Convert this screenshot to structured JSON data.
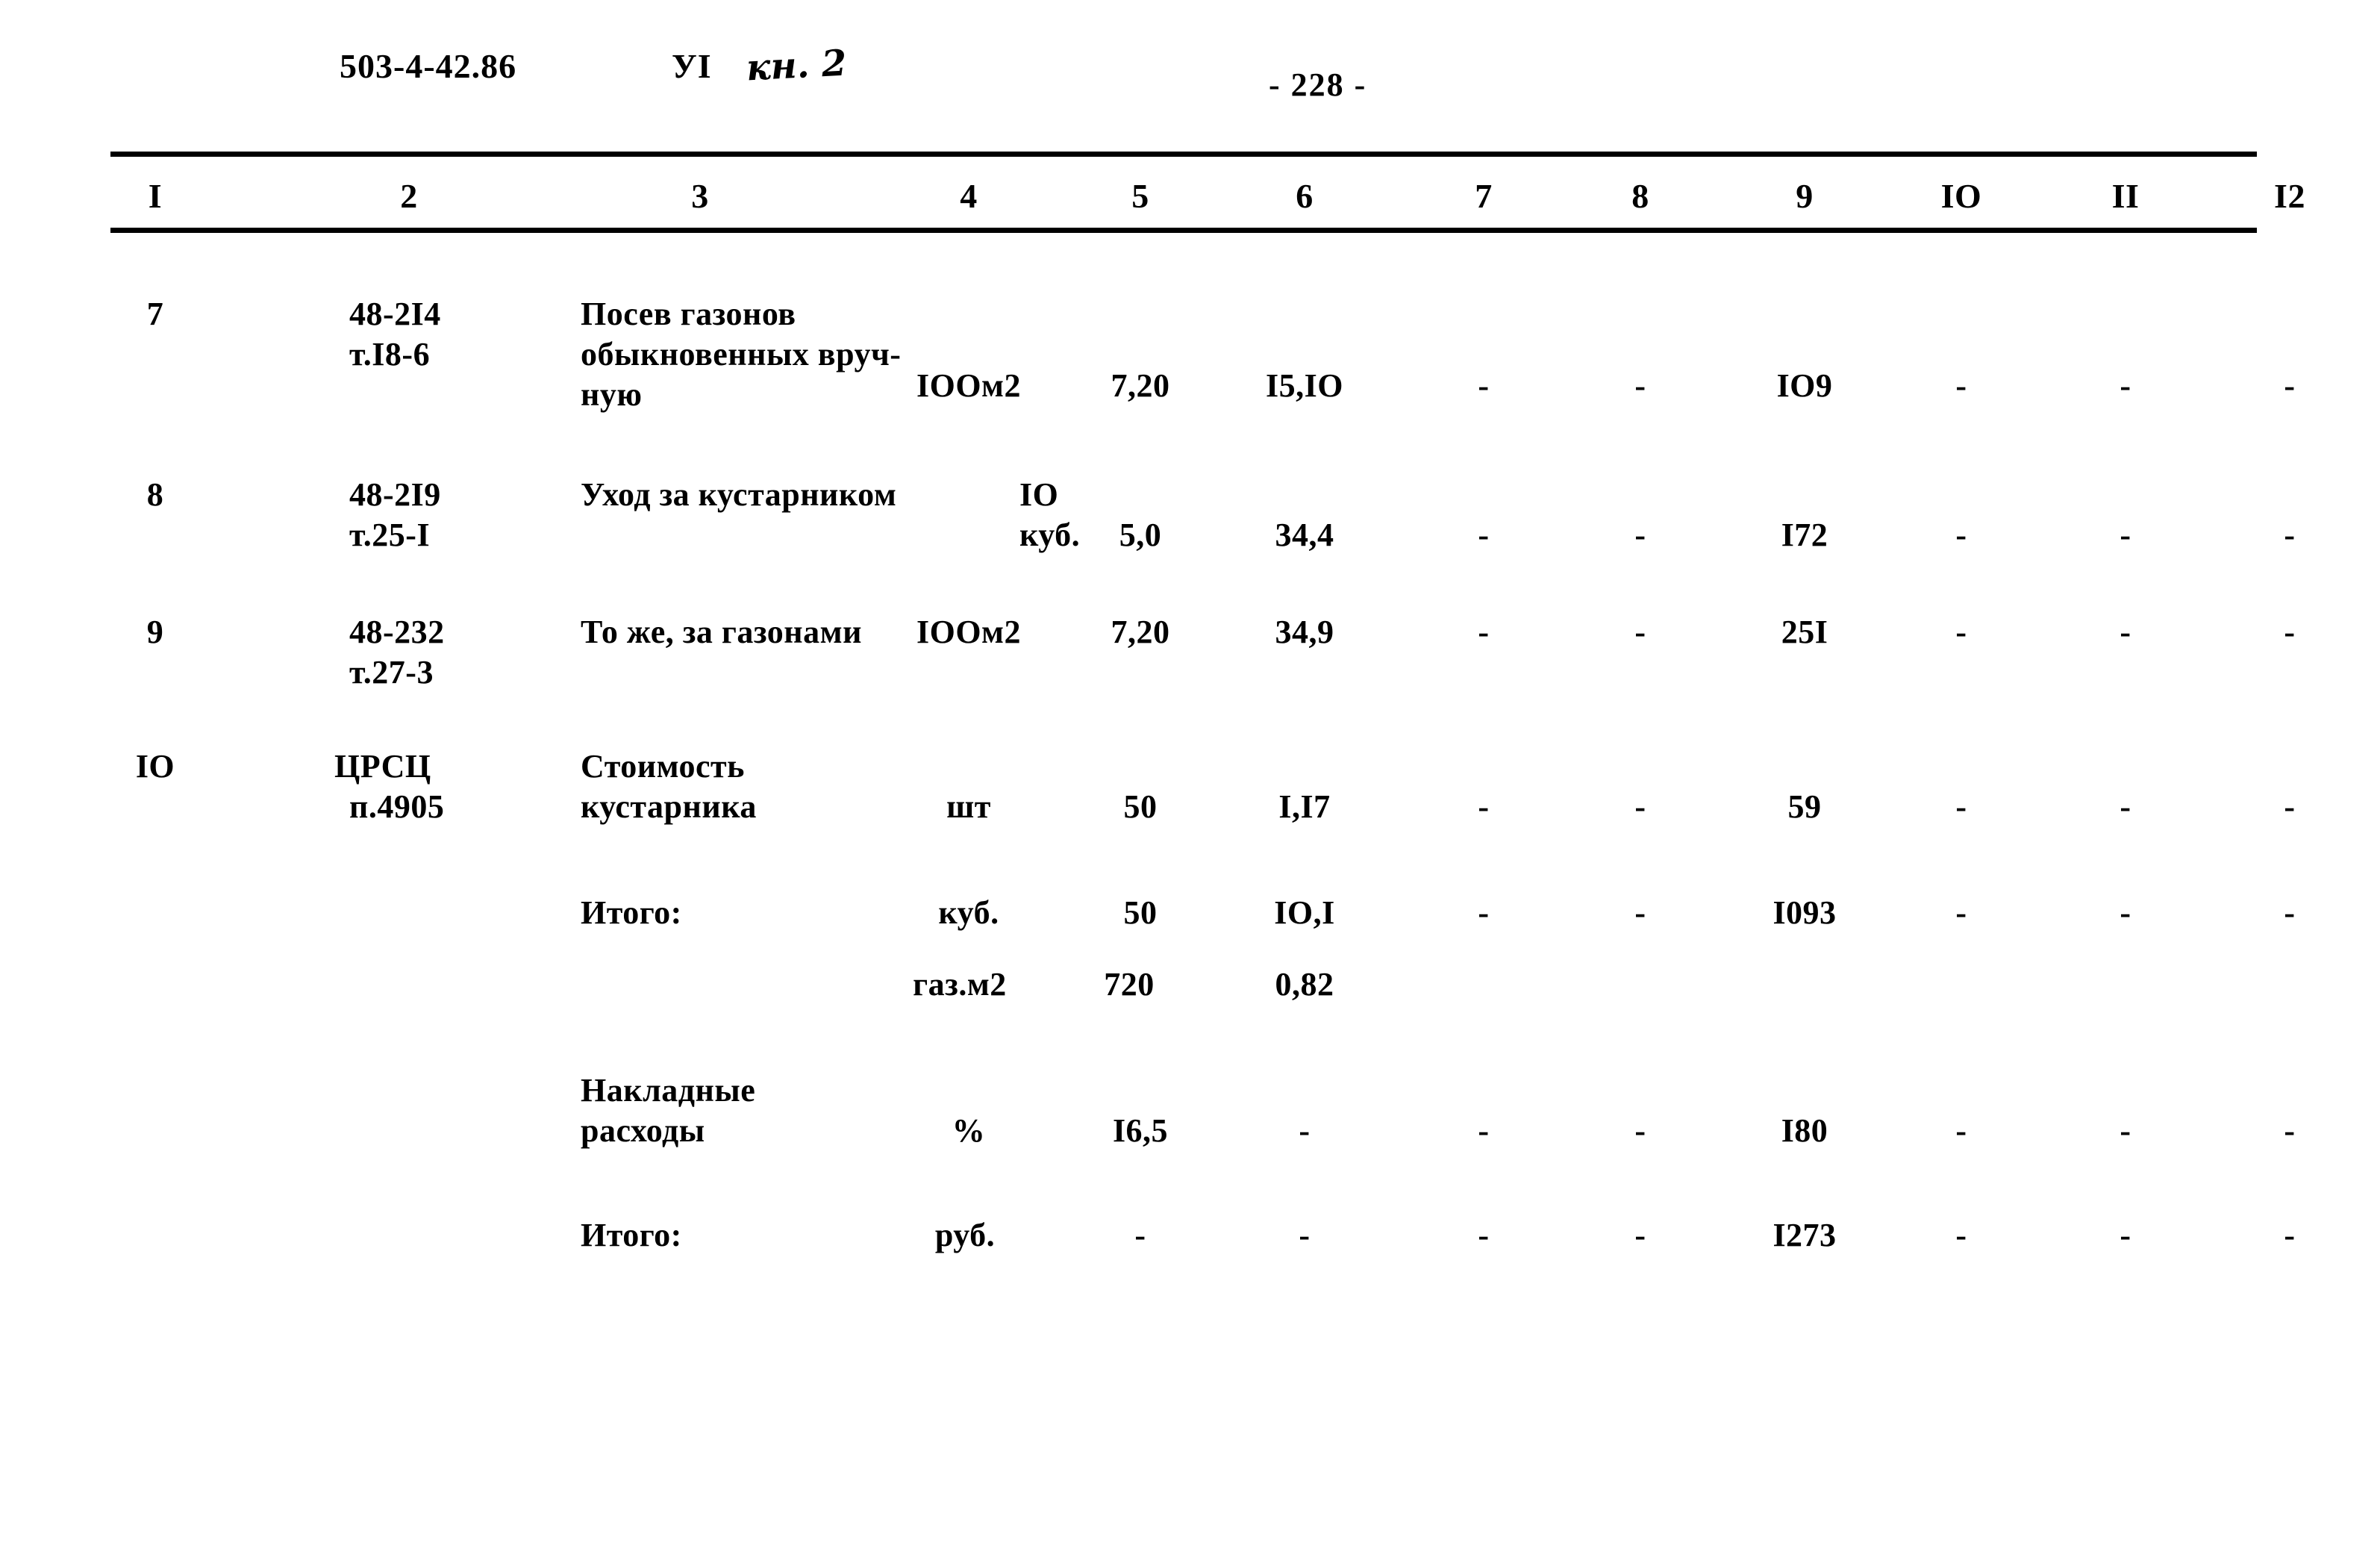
{
  "header": {
    "doc_code": "503-4-42.86",
    "volume": "УI",
    "handwritten_note": "кн. 2",
    "page_number": "- 228 -"
  },
  "table": {
    "column_headers": [
      "I",
      "2",
      "3",
      "4",
      "5",
      "6",
      "7",
      "8",
      "9",
      "IO",
      "II",
      "I2"
    ],
    "rows": [
      {
        "num": "7",
        "code_line1": "48-2I4",
        "code_line2": "т.I8-6",
        "desc_line1": "Посев газонов",
        "desc_line2": "обыкновенных вруч-",
        "desc_line3": "ную",
        "c4": "IOOм2",
        "c5": "7,20",
        "c6": "I5,IO",
        "c7": "-",
        "c8": "-",
        "c9": "IO9",
        "c10": "-",
        "c11": "-",
        "c12": "-"
      },
      {
        "num": "8",
        "code_line1": "48-2I9",
        "code_line2": "т.25-I",
        "desc_line1": "Уход за кустарником",
        "desc_line2": "",
        "desc_line3": "",
        "c4_line1": "IO",
        "c4": "куб.",
        "c5": "5,0",
        "c6": "34,4",
        "c7": "-",
        "c8": "-",
        "c9": "I72",
        "c10": "-",
        "c11": "-",
        "c12": "-"
      },
      {
        "num": "9",
        "code_line1": "48-232",
        "code_line2": "т.27-3",
        "desc_line1": "То же, за газонами",
        "desc_line2": "",
        "desc_line3": "",
        "c4": "IOOм2",
        "c5": "7,20",
        "c6": "34,9",
        "c7": "-",
        "c8": "-",
        "c9": "25I",
        "c10": "-",
        "c11": "-",
        "c12": "-"
      },
      {
        "num": "IO",
        "code_line1": "ЦРСЦ",
        "code_line2": "п.4905",
        "desc_line1": "Стоимость",
        "desc_line2": "кустарника",
        "desc_line3": "",
        "c4": "шт",
        "c5": "50",
        "c6": "I,I7",
        "c7": "-",
        "c8": "-",
        "c9": "59",
        "c10": "-",
        "c11": "-",
        "c12": "-"
      },
      {
        "num": "",
        "code_line1": "",
        "code_line2": "",
        "desc_line1": "Итого:",
        "desc_line2": "",
        "desc_line3": "",
        "c4": "куб.",
        "c5": "50",
        "c6": "IO,I",
        "c7": "-",
        "c8": "-",
        "c9": "I093",
        "c10": "-",
        "c11": "-",
        "c12": "-"
      },
      {
        "num": "",
        "code_line1": "",
        "code_line2": "",
        "desc_line1": "",
        "desc_line2": "",
        "desc_line3": "",
        "c4": "газ.м2",
        "c5": "720",
        "c6": "0,82",
        "c7": "",
        "c8": "",
        "c9": "",
        "c10": "",
        "c11": "",
        "c12": ""
      },
      {
        "num": "",
        "code_line1": "",
        "code_line2": "",
        "desc_line1": "Накладные",
        "desc_line2": "расходы",
        "desc_line3": "",
        "c4": "%",
        "c5": "I6,5",
        "c6": "-",
        "c7": "-",
        "c8": "-",
        "c9": "I80",
        "c10": "-",
        "c11": "-",
        "c12": "-"
      },
      {
        "num": "",
        "code_line1": "",
        "code_line2": "",
        "desc_line1": "Итого:",
        "desc_line2": "",
        "desc_line3": "",
        "c4": "руб.",
        "c5": "-",
        "c6": "-",
        "c7": "-",
        "c8": "-",
        "c9": "I273",
        "c10": "-",
        "c11": "-",
        "c12": "-"
      }
    ]
  }
}
